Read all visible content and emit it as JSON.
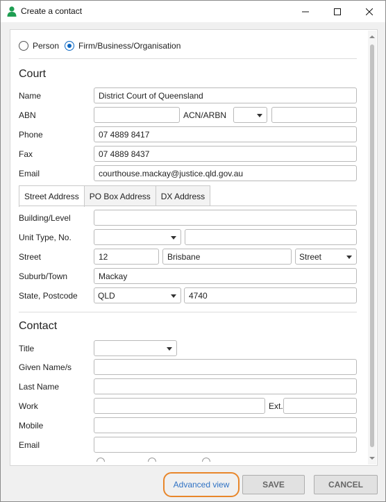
{
  "window": {
    "title": "Create a contact",
    "icon": "person-icon",
    "accent_color": "#0a66c2",
    "highlight_color": "#e8862a"
  },
  "entity_type": {
    "options": [
      "Person",
      "Firm/Business/Organisation"
    ],
    "selected": "Firm/Business/Organisation"
  },
  "court": {
    "heading": "Court",
    "labels": {
      "name": "Name",
      "abn": "ABN",
      "acn": "ACN/ARBN",
      "phone": "Phone",
      "fax": "Fax",
      "email": "Email"
    },
    "values": {
      "name": "District Court of Queensland",
      "abn": "",
      "acn_type": "",
      "acn": "",
      "phone": "07 4889 8417",
      "fax": "07 4889 8437",
      "email": "courthouse.mackay@justice.qld.gov.au"
    }
  },
  "address_tabs": {
    "tabs": [
      "Street Address",
      "PO Box Address",
      "DX Address"
    ],
    "active": "Street Address"
  },
  "address": {
    "labels": {
      "building": "Building/Level",
      "unit": "Unit Type, No.",
      "street": "Street",
      "suburb": "Suburb/Town",
      "state": "State, Postcode"
    },
    "values": {
      "building": "",
      "unit_type": "",
      "unit_no": "",
      "street_number": "12",
      "street_name": "Brisbane",
      "street_type": "Street",
      "suburb": "Mackay",
      "state": "QLD",
      "postcode": "4740"
    }
  },
  "contact": {
    "heading": "Contact",
    "labels": {
      "title": "Title",
      "given": "Given Name/s",
      "last": "Last Name",
      "work": "Work",
      "ext": "Ext.",
      "mobile": "Mobile",
      "email": "Email"
    },
    "values": {
      "title": "",
      "given": "",
      "last": "",
      "work": "",
      "ext": "",
      "mobile": "",
      "email": ""
    }
  },
  "footer": {
    "advanced_view": "Advanced view",
    "save": "SAVE",
    "cancel": "CANCEL"
  }
}
